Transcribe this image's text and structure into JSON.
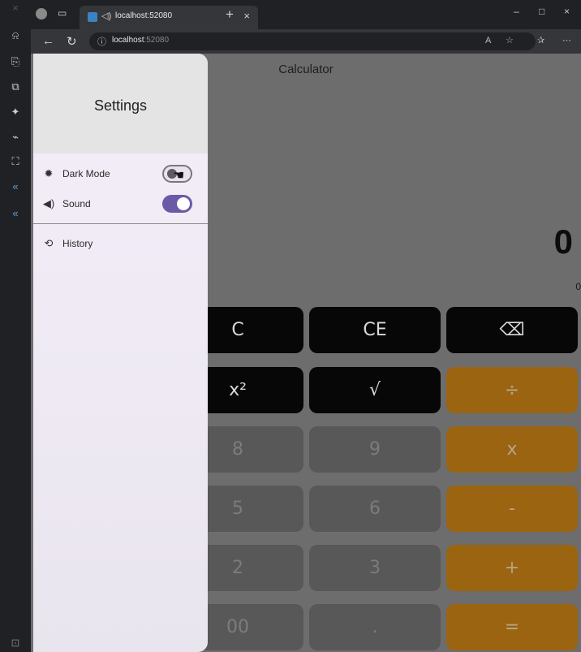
{
  "browser": {
    "tab_title": "localhost:52080",
    "tab_close": "×",
    "new_tab": "+",
    "url_host": "localhost",
    "url_port": ":52080",
    "window_minimize": "–",
    "window_maximize": "□",
    "window_close": "×"
  },
  "app": {
    "title": "Calculator",
    "display_value": "0",
    "display_expression": "0"
  },
  "drawer": {
    "title": "Settings",
    "items": [
      {
        "label": "Dark Mode",
        "icon": "sun-icon",
        "toggle": false
      },
      {
        "label": "Sound",
        "icon": "speaker-icon",
        "toggle": true
      },
      {
        "label": "History",
        "icon": "history-icon"
      }
    ]
  },
  "keypad": {
    "rows": [
      [
        "C",
        "CE",
        "⌫"
      ],
      [
        "x²",
        "√",
        "÷"
      ],
      [
        "8",
        "9",
        "x"
      ],
      [
        "5",
        "6",
        "-"
      ],
      [
        "2",
        "3",
        "+"
      ],
      [
        "00",
        ".",
        "="
      ]
    ]
  },
  "colors": {
    "accent": "#6a5aa8",
    "operator": "#9a6410",
    "function_key": "#070707",
    "number_key": "#585858"
  }
}
